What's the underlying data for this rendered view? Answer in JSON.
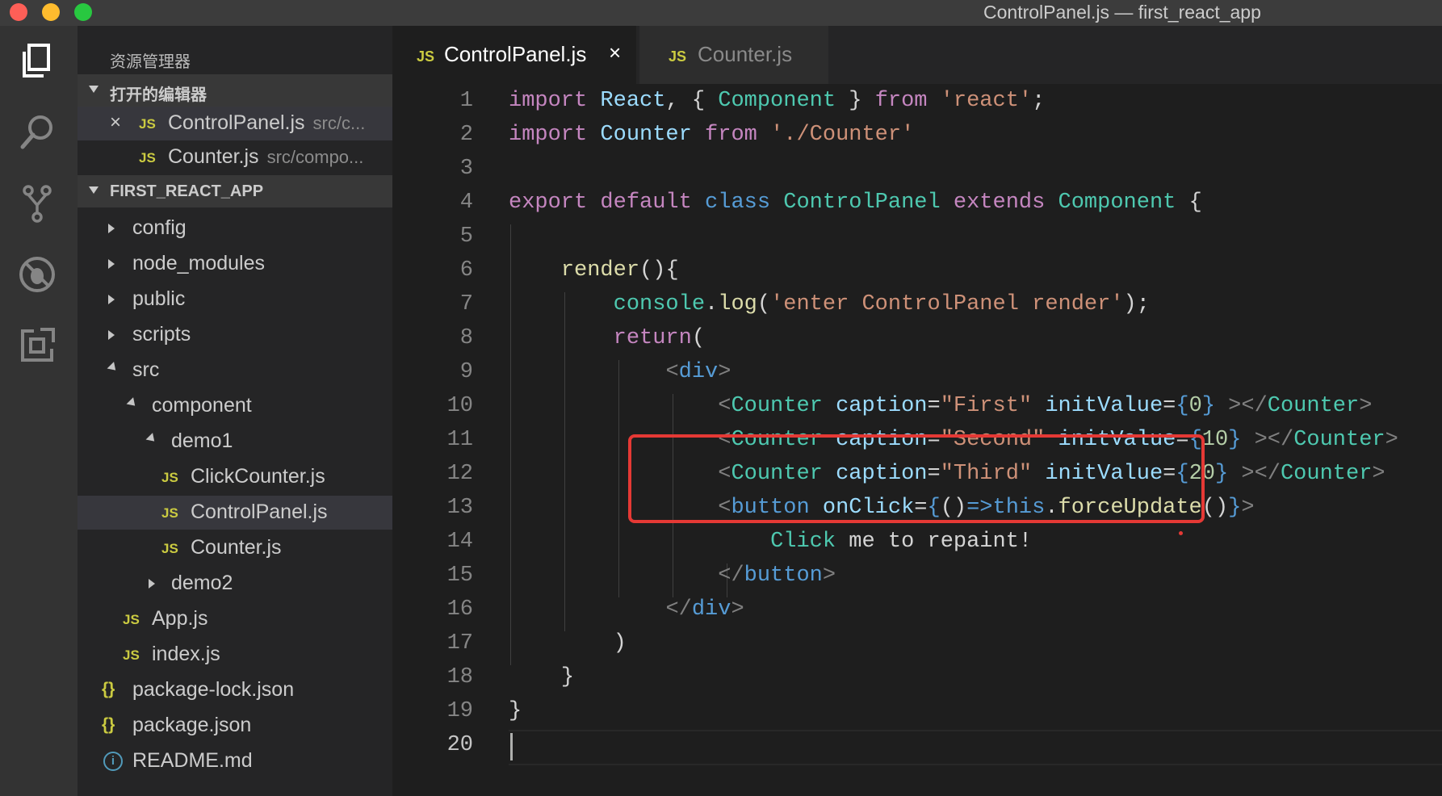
{
  "window": {
    "title": "ControlPanel.js — first_react_app"
  },
  "activity": [
    {
      "name": "files-icon"
    },
    {
      "name": "search-icon"
    },
    {
      "name": "source-control-icon"
    },
    {
      "name": "debug-icon"
    },
    {
      "name": "extensions-icon"
    }
  ],
  "sidebar": {
    "title": "资源管理器",
    "open_editors": {
      "header": "打开的编辑器",
      "items": [
        {
          "name": "ControlPanel.js",
          "desc": "src/c..."
        },
        {
          "name": "Counter.js",
          "desc": "src/compo..."
        }
      ]
    },
    "project": {
      "header": "FIRST_REACT_APP",
      "tree": [
        {
          "label": "config"
        },
        {
          "label": "node_modules"
        },
        {
          "label": "public"
        },
        {
          "label": "scripts"
        },
        {
          "label": "src"
        },
        {
          "label": "component"
        },
        {
          "label": "demo1"
        },
        {
          "label": "ClickCounter.js"
        },
        {
          "label": "ControlPanel.js"
        },
        {
          "label": "Counter.js"
        },
        {
          "label": "demo2"
        },
        {
          "label": "App.js"
        },
        {
          "label": "index.js"
        },
        {
          "label": "package-lock.json"
        },
        {
          "label": "package.json"
        },
        {
          "label": "README.md"
        }
      ]
    }
  },
  "tabs": [
    {
      "icon": "JS",
      "label": "ControlPanel.js",
      "close": "×"
    },
    {
      "icon": "JS",
      "label": "Counter.js"
    }
  ],
  "icons": {
    "js": "JS",
    "json": "{}",
    "info": "i",
    "close": "×"
  },
  "editor": {
    "line_numbers": [
      "1",
      "2",
      "3",
      "4",
      "5",
      "6",
      "7",
      "8",
      "9",
      "10",
      "11",
      "12",
      "13",
      "14",
      "15",
      "16",
      "17",
      "18",
      "19",
      "20"
    ],
    "current_line": "20",
    "lines": [
      "import React, { Component } from 'react';",
      "import Counter from './Counter'",
      "",
      "export default class ControlPanel extends Component {",
      "",
      "    render(){",
      "        console.log('enter ControlPanel render');",
      "        return(",
      "            <div>",
      "                <Counter caption=\"First\" initValue={0} ></Counter>",
      "                <Counter caption=\"Second\" initValue={10} ></Counter>",
      "                <Counter caption=\"Third\" initValue={20} ></Counter>",
      "                <button onClick={()=>this.forceUpdate()}>",
      "                    Click me to repaint!",
      "                </button>",
      "            </div>",
      "        )",
      "    }",
      "}",
      ""
    ]
  },
  "colors": {
    "keyword": "#c586c0",
    "storage": "#569cd6",
    "type": "#4ec9b0",
    "string": "#ce9178",
    "function": "#dcdcaa",
    "attribute": "#9cdcfe",
    "number": "#b5cea8",
    "punctuation": "#808080",
    "annotation_box": "#e53935"
  }
}
